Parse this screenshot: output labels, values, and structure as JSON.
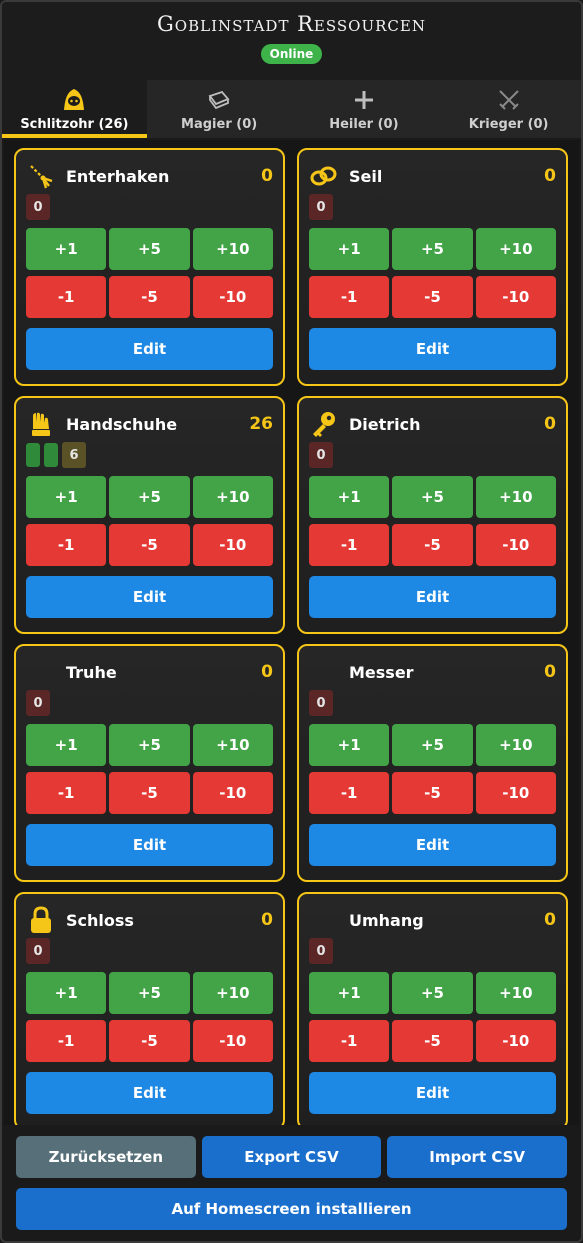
{
  "app": {
    "title": "Goblinstadt Ressourcen",
    "status": "Online"
  },
  "tabs": [
    {
      "label": "Schlitzohr (26)",
      "icon": "hooded-rogue-icon",
      "active": true
    },
    {
      "label": "Magier (0)",
      "icon": "spellbook-icon",
      "active": false
    },
    {
      "label": "Heiler (0)",
      "icon": "plus-cross-icon",
      "active": false
    },
    {
      "label": "Krieger (0)",
      "icon": "crossed-swords-icon",
      "active": false
    }
  ],
  "buttons": {
    "p1": "+1",
    "p5": "+5",
    "p10": "+10",
    "m1": "-1",
    "m5": "-5",
    "m10": "-10",
    "edit": "Edit"
  },
  "items": [
    {
      "name": "Enterhaken",
      "count": "0",
      "badge": "0",
      "icon": "grappling-hook-icon"
    },
    {
      "name": "Seil",
      "count": "0",
      "badge": "0",
      "icon": "rope-icon"
    },
    {
      "name": "Handschuhe",
      "count": "26",
      "badge": "6",
      "icon": "glove-icon",
      "full_segments": 2
    },
    {
      "name": "Dietrich",
      "count": "0",
      "badge": "0",
      "icon": "key-icon"
    },
    {
      "name": "Truhe",
      "count": "0",
      "badge": "0",
      "icon": ""
    },
    {
      "name": "Messer",
      "count": "0",
      "badge": "0",
      "icon": ""
    },
    {
      "name": "Schloss",
      "count": "0",
      "badge": "0",
      "icon": "padlock-icon"
    },
    {
      "name": "Umhang",
      "count": "0",
      "badge": "0",
      "icon": ""
    }
  ],
  "footer": {
    "reset": "Zurücksetzen",
    "export": "Export CSV",
    "import": "Import CSV",
    "install": "Auf Homescreen installieren"
  },
  "colors": {
    "accent": "#f5c518",
    "plus": "#43a447",
    "minus": "#e53935",
    "edit": "#1e88e5",
    "online": "#3db34a"
  }
}
